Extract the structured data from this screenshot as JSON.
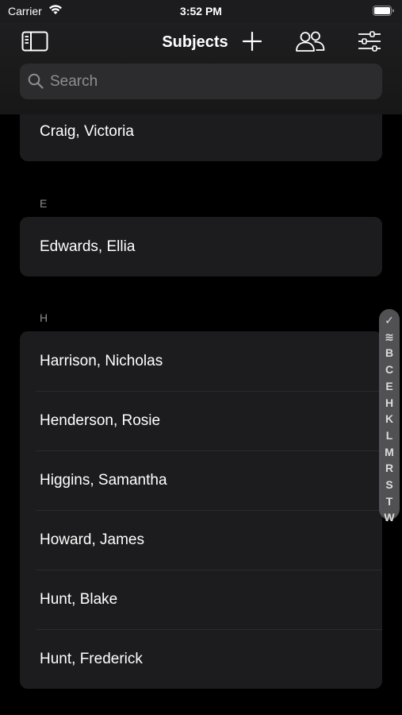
{
  "status_bar": {
    "carrier": "Carrier",
    "time": "3:52 PM"
  },
  "nav": {
    "title": "Subjects",
    "icons": [
      "sidebar-icon",
      "plus-icon",
      "people-icon",
      "sliders-icon"
    ]
  },
  "search": {
    "placeholder": "Search"
  },
  "list": {
    "partial_top": "Craig, Victoria",
    "sections": [
      {
        "letter": "E",
        "items": [
          "Edwards, Ellia"
        ]
      },
      {
        "letter": "H",
        "items": [
          "Harrison, Nicholas",
          "Henderson, Rosie",
          "Higgins, Samantha",
          "Howard, James",
          "Hunt, Blake",
          "Hunt, Frederick"
        ]
      }
    ]
  },
  "index_bar": {
    "letters": [
      "✓",
      "≋",
      "B",
      "C",
      "E",
      "H",
      "K",
      "L",
      "M",
      "R",
      "S",
      "T",
      "W"
    ]
  },
  "colors": {
    "background": "#000000",
    "card": "#1c1c1e",
    "secondary_text": "#8e8e93"
  }
}
